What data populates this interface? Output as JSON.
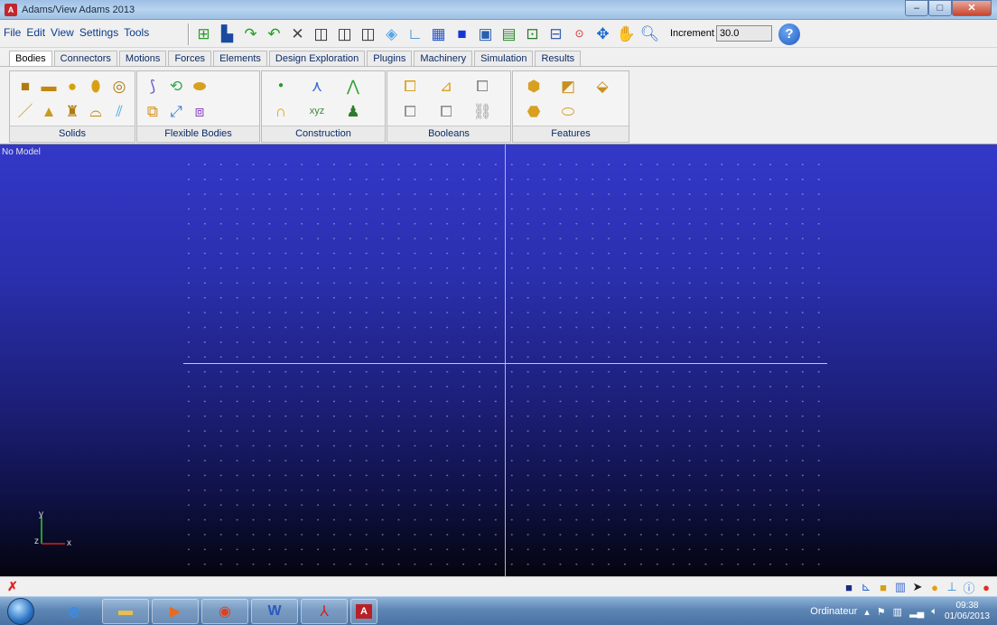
{
  "window": {
    "title": "Adams/View Adams 2013",
    "icon_letter": "A",
    "minimize_icon": "minimize-icon",
    "maximize_icon": "maximize-icon",
    "close_icon": "close-icon"
  },
  "menu": {
    "items": [
      "File",
      "Edit",
      "View",
      "Settings",
      "Tools"
    ]
  },
  "toolbar": {
    "icons": [
      "import-icon",
      "save-icon",
      "redo-icon",
      "undo-icon",
      "select-icon",
      "iso-view-icon",
      "front-view-icon",
      "top-view-icon",
      "render-icon",
      "axes-icon",
      "grid-icon",
      "shade-icon",
      "window-icon",
      "fit-icon",
      "zoom-box-icon",
      "center-icon",
      "translate-icon",
      "pan-hand-icon",
      "zoom-icon"
    ],
    "increment_label": "Increment",
    "increment_value": "30.0",
    "help_icon": "help-icon"
  },
  "tabs": [
    {
      "label": "Bodies",
      "active": true
    },
    {
      "label": "Connectors"
    },
    {
      "label": "Motions"
    },
    {
      "label": "Forces"
    },
    {
      "label": "Elements"
    },
    {
      "label": "Design Exploration"
    },
    {
      "label": "Plugins"
    },
    {
      "label": "Machinery"
    },
    {
      "label": "Simulation"
    },
    {
      "label": "Results"
    }
  ],
  "ribbon": {
    "groups": [
      {
        "label": "Solids",
        "icons": [
          "box-icon",
          "cylinder-icon",
          "sphere-icon",
          "frustum-icon",
          "torus-icon",
          "link-icon",
          "extrusion-icon",
          "plate-icon",
          "revolution-icon",
          "polyline-icon"
        ]
      },
      {
        "label": "Flexible Bodies",
        "icons": [
          "flex-body-icon",
          "discrete-flex-icon",
          "beam-icon",
          "swap-flex-icon",
          "flex-link-icon",
          "view-flex-icon"
        ]
      },
      {
        "label": "Construction",
        "icons": [
          "point-icon",
          "marker-icon",
          "polyline-icon",
          "arc-icon",
          "spline-icon",
          "create-body-icon"
        ]
      },
      {
        "label": "Booleans",
        "icons": [
          "union-icon",
          "merge-icon",
          "intersect-icon",
          "cut-icon",
          "split-icon",
          "chain-icon"
        ]
      },
      {
        "label": "Features",
        "icons": [
          "chamfer-icon",
          "blend-icon",
          "hollow-icon",
          "hole-icon",
          "boss-icon"
        ]
      }
    ]
  },
  "viewport": {
    "model_label": "No Model",
    "axis_x": "x",
    "axis_y": "y",
    "axis_z": "z"
  },
  "statusbar": {
    "left_icon": "cancel-icon",
    "icons": [
      "color-icon",
      "shell-icon",
      "info-icon",
      "table-icon",
      "arrow-icon",
      "sphere-render-icon",
      "tree-icon",
      "info-circle-icon",
      "stop-icon"
    ]
  },
  "taskbar": {
    "items": [
      "internet-explorer-icon",
      "file-explorer-icon",
      "media-player-icon",
      "chrome-icon",
      "word-icon",
      "acrobat-icon",
      "adams-icon"
    ],
    "tray_label": "Ordinateur",
    "time": "09:38",
    "date": "01/06/2013"
  },
  "colors": {
    "viewport_top": "#3338c8",
    "viewport_bottom": "#04050e",
    "taskbar": "#5d86b5"
  }
}
